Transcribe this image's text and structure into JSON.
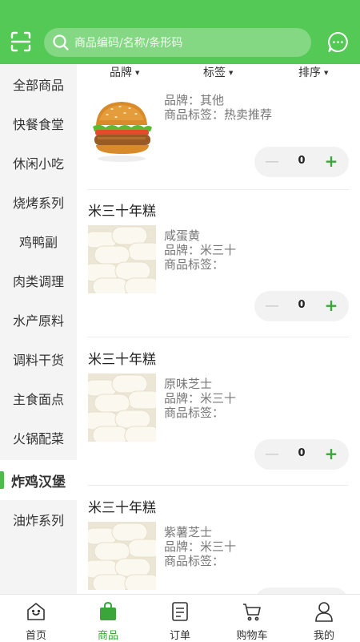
{
  "header": {
    "search_placeholder": "商品编码/名称/条形码"
  },
  "sidebar": {
    "items": [
      {
        "label": "全部商品"
      },
      {
        "label": "快餐食堂"
      },
      {
        "label": "休闲小吃"
      },
      {
        "label": "烧烤系列"
      },
      {
        "label": "鸡鸭副"
      },
      {
        "label": "肉类调理"
      },
      {
        "label": "水产原料"
      },
      {
        "label": "调料干货"
      },
      {
        "label": "主食面点"
      },
      {
        "label": "火锅配菜"
      },
      {
        "label": "炸鸡汉堡"
      },
      {
        "label": "油炸系列"
      }
    ],
    "active_index": 10
  },
  "filters": {
    "brand": "品牌",
    "tag": "标签",
    "sort": "排序"
  },
  "products": [
    {
      "title": "",
      "name": "",
      "brand": "品牌：其他",
      "tag": "商品标签：热卖推荐",
      "qty": "0",
      "image": "burger"
    },
    {
      "title": "米三十年糕",
      "name": "咸蛋黄",
      "brand": "品牌：米三十",
      "tag": "商品标签：",
      "qty": "0",
      "image": "rice-cake"
    },
    {
      "title": "米三十年糕",
      "name": "原味芝士",
      "brand": "品牌：米三十",
      "tag": "商品标签：",
      "qty": "0",
      "image": "rice-cake"
    },
    {
      "title": "米三十年糕",
      "name": "紫薯芝士",
      "brand": "品牌：米三十",
      "tag": "商品标签：",
      "qty": "",
      "image": "rice-cake"
    }
  ],
  "tabbar": {
    "items": [
      {
        "label": "首页",
        "icon": "home-icon"
      },
      {
        "label": "商品",
        "icon": "bag-icon"
      },
      {
        "label": "订单",
        "icon": "order-icon"
      },
      {
        "label": "购物车",
        "icon": "cart-icon"
      },
      {
        "label": "我的",
        "icon": "user-icon"
      }
    ],
    "active_index": 1
  },
  "colors": {
    "brand_green": "#55c955",
    "plus_green": "#3aa63a",
    "sidebar_bg": "#f4f4f4"
  }
}
